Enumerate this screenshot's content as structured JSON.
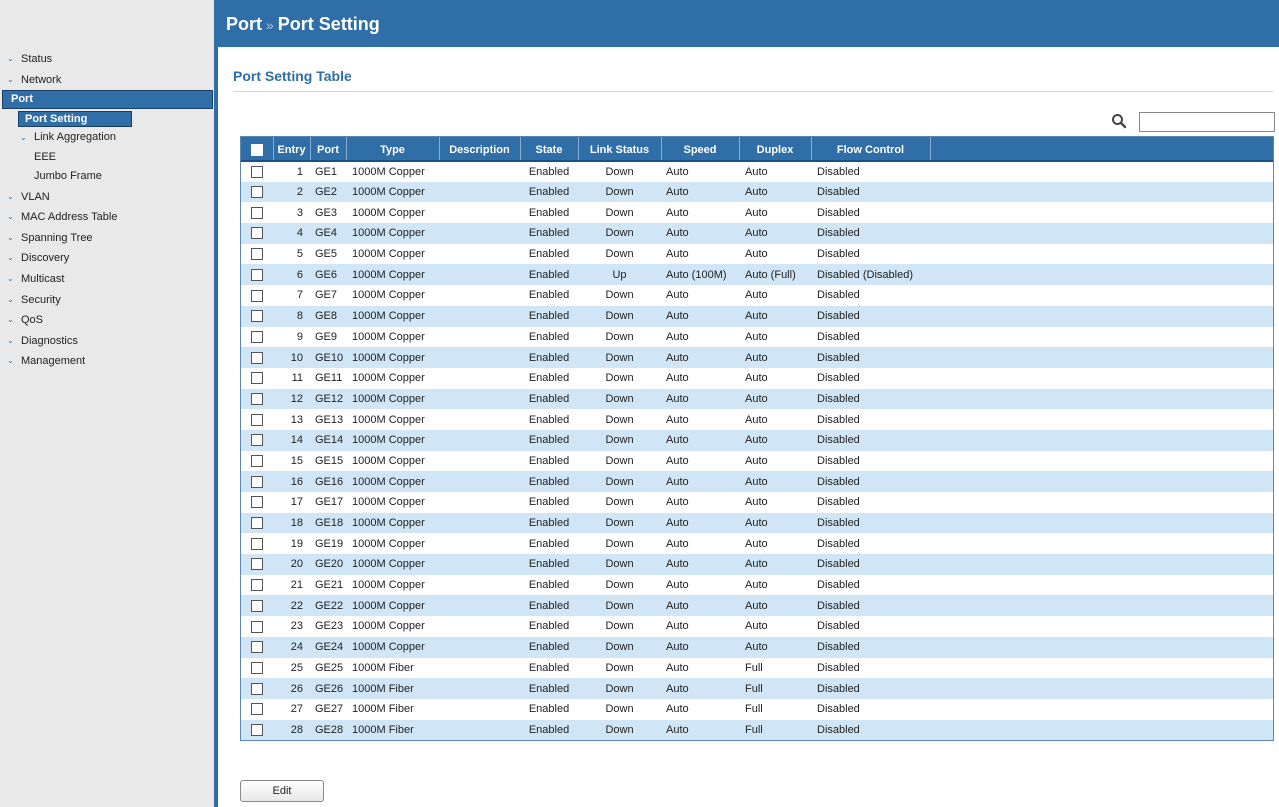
{
  "header": {
    "section": "Port",
    "separator": "»",
    "page": "Port Setting"
  },
  "sidebar": {
    "items": [
      {
        "label": "Status",
        "level": 0,
        "expandable": true
      },
      {
        "label": "Network",
        "level": 0,
        "expandable": true
      },
      {
        "label": "Port",
        "level": 0,
        "active": true
      },
      {
        "label": "Port Setting",
        "level": 1,
        "active": true
      },
      {
        "label": "Link Aggregation",
        "level": 1,
        "expandable": true
      },
      {
        "label": "EEE",
        "level": 1
      },
      {
        "label": "Jumbo Frame",
        "level": 1
      },
      {
        "label": "VLAN",
        "level": 0,
        "expandable": true
      },
      {
        "label": "MAC Address Table",
        "level": 0,
        "expandable": true
      },
      {
        "label": "Spanning Tree",
        "level": 0,
        "expandable": true
      },
      {
        "label": "Discovery",
        "level": 0,
        "expandable": true
      },
      {
        "label": "Multicast",
        "level": 0,
        "expandable": true
      },
      {
        "label": "Security",
        "level": 0,
        "expandable": true
      },
      {
        "label": "QoS",
        "level": 0,
        "expandable": true
      },
      {
        "label": "Diagnostics",
        "level": 0,
        "expandable": true
      },
      {
        "label": "Management",
        "level": 0,
        "expandable": true
      }
    ]
  },
  "main": {
    "title": "Port Setting Table",
    "search": {
      "value": "",
      "icon": "search-icon"
    },
    "columns": [
      "Entry",
      "Port",
      "Type",
      "Description",
      "State",
      "Link Status",
      "Speed",
      "Duplex",
      "Flow Control"
    ],
    "rows": [
      [
        "1",
        "GE1",
        "1000M Copper",
        "",
        "Enabled",
        "Down",
        "Auto",
        "Auto",
        "Disabled"
      ],
      [
        "2",
        "GE2",
        "1000M Copper",
        "",
        "Enabled",
        "Down",
        "Auto",
        "Auto",
        "Disabled"
      ],
      [
        "3",
        "GE3",
        "1000M Copper",
        "",
        "Enabled",
        "Down",
        "Auto",
        "Auto",
        "Disabled"
      ],
      [
        "4",
        "GE4",
        "1000M Copper",
        "",
        "Enabled",
        "Down",
        "Auto",
        "Auto",
        "Disabled"
      ],
      [
        "5",
        "GE5",
        "1000M Copper",
        "",
        "Enabled",
        "Down",
        "Auto",
        "Auto",
        "Disabled"
      ],
      [
        "6",
        "GE6",
        "1000M Copper",
        "",
        "Enabled",
        "Up",
        "Auto (100M)",
        "Auto (Full)",
        "Disabled (Disabled)"
      ],
      [
        "7",
        "GE7",
        "1000M Copper",
        "",
        "Enabled",
        "Down",
        "Auto",
        "Auto",
        "Disabled"
      ],
      [
        "8",
        "GE8",
        "1000M Copper",
        "",
        "Enabled",
        "Down",
        "Auto",
        "Auto",
        "Disabled"
      ],
      [
        "9",
        "GE9",
        "1000M Copper",
        "",
        "Enabled",
        "Down",
        "Auto",
        "Auto",
        "Disabled"
      ],
      [
        "10",
        "GE10",
        "1000M Copper",
        "",
        "Enabled",
        "Down",
        "Auto",
        "Auto",
        "Disabled"
      ],
      [
        "11",
        "GE11",
        "1000M Copper",
        "",
        "Enabled",
        "Down",
        "Auto",
        "Auto",
        "Disabled"
      ],
      [
        "12",
        "GE12",
        "1000M Copper",
        "",
        "Enabled",
        "Down",
        "Auto",
        "Auto",
        "Disabled"
      ],
      [
        "13",
        "GE13",
        "1000M Copper",
        "",
        "Enabled",
        "Down",
        "Auto",
        "Auto",
        "Disabled"
      ],
      [
        "14",
        "GE14",
        "1000M Copper",
        "",
        "Enabled",
        "Down",
        "Auto",
        "Auto",
        "Disabled"
      ],
      [
        "15",
        "GE15",
        "1000M Copper",
        "",
        "Enabled",
        "Down",
        "Auto",
        "Auto",
        "Disabled"
      ],
      [
        "16",
        "GE16",
        "1000M Copper",
        "",
        "Enabled",
        "Down",
        "Auto",
        "Auto",
        "Disabled"
      ],
      [
        "17",
        "GE17",
        "1000M Copper",
        "",
        "Enabled",
        "Down",
        "Auto",
        "Auto",
        "Disabled"
      ],
      [
        "18",
        "GE18",
        "1000M Copper",
        "",
        "Enabled",
        "Down",
        "Auto",
        "Auto",
        "Disabled"
      ],
      [
        "19",
        "GE19",
        "1000M Copper",
        "",
        "Enabled",
        "Down",
        "Auto",
        "Auto",
        "Disabled"
      ],
      [
        "20",
        "GE20",
        "1000M Copper",
        "",
        "Enabled",
        "Down",
        "Auto",
        "Auto",
        "Disabled"
      ],
      [
        "21",
        "GE21",
        "1000M Copper",
        "",
        "Enabled",
        "Down",
        "Auto",
        "Auto",
        "Disabled"
      ],
      [
        "22",
        "GE22",
        "1000M Copper",
        "",
        "Enabled",
        "Down",
        "Auto",
        "Auto",
        "Disabled"
      ],
      [
        "23",
        "GE23",
        "1000M Copper",
        "",
        "Enabled",
        "Down",
        "Auto",
        "Auto",
        "Disabled"
      ],
      [
        "24",
        "GE24",
        "1000M Copper",
        "",
        "Enabled",
        "Down",
        "Auto",
        "Auto",
        "Disabled"
      ],
      [
        "25",
        "GE25",
        "1000M Fiber",
        "",
        "Enabled",
        "Down",
        "Auto",
        "Full",
        "Disabled"
      ],
      [
        "26",
        "GE26",
        "1000M Fiber",
        "",
        "Enabled",
        "Down",
        "Auto",
        "Full",
        "Disabled"
      ],
      [
        "27",
        "GE27",
        "1000M Fiber",
        "",
        "Enabled",
        "Down",
        "Auto",
        "Full",
        "Disabled"
      ],
      [
        "28",
        "GE28",
        "1000M Fiber",
        "",
        "Enabled",
        "Down",
        "Auto",
        "Full",
        "Disabled"
      ]
    ],
    "edit_label": "Edit"
  },
  "colors": {
    "accent": "#2f6ea6",
    "row_alt": "#d0e6f6",
    "sidebar_bg": "#e9e9e9"
  }
}
